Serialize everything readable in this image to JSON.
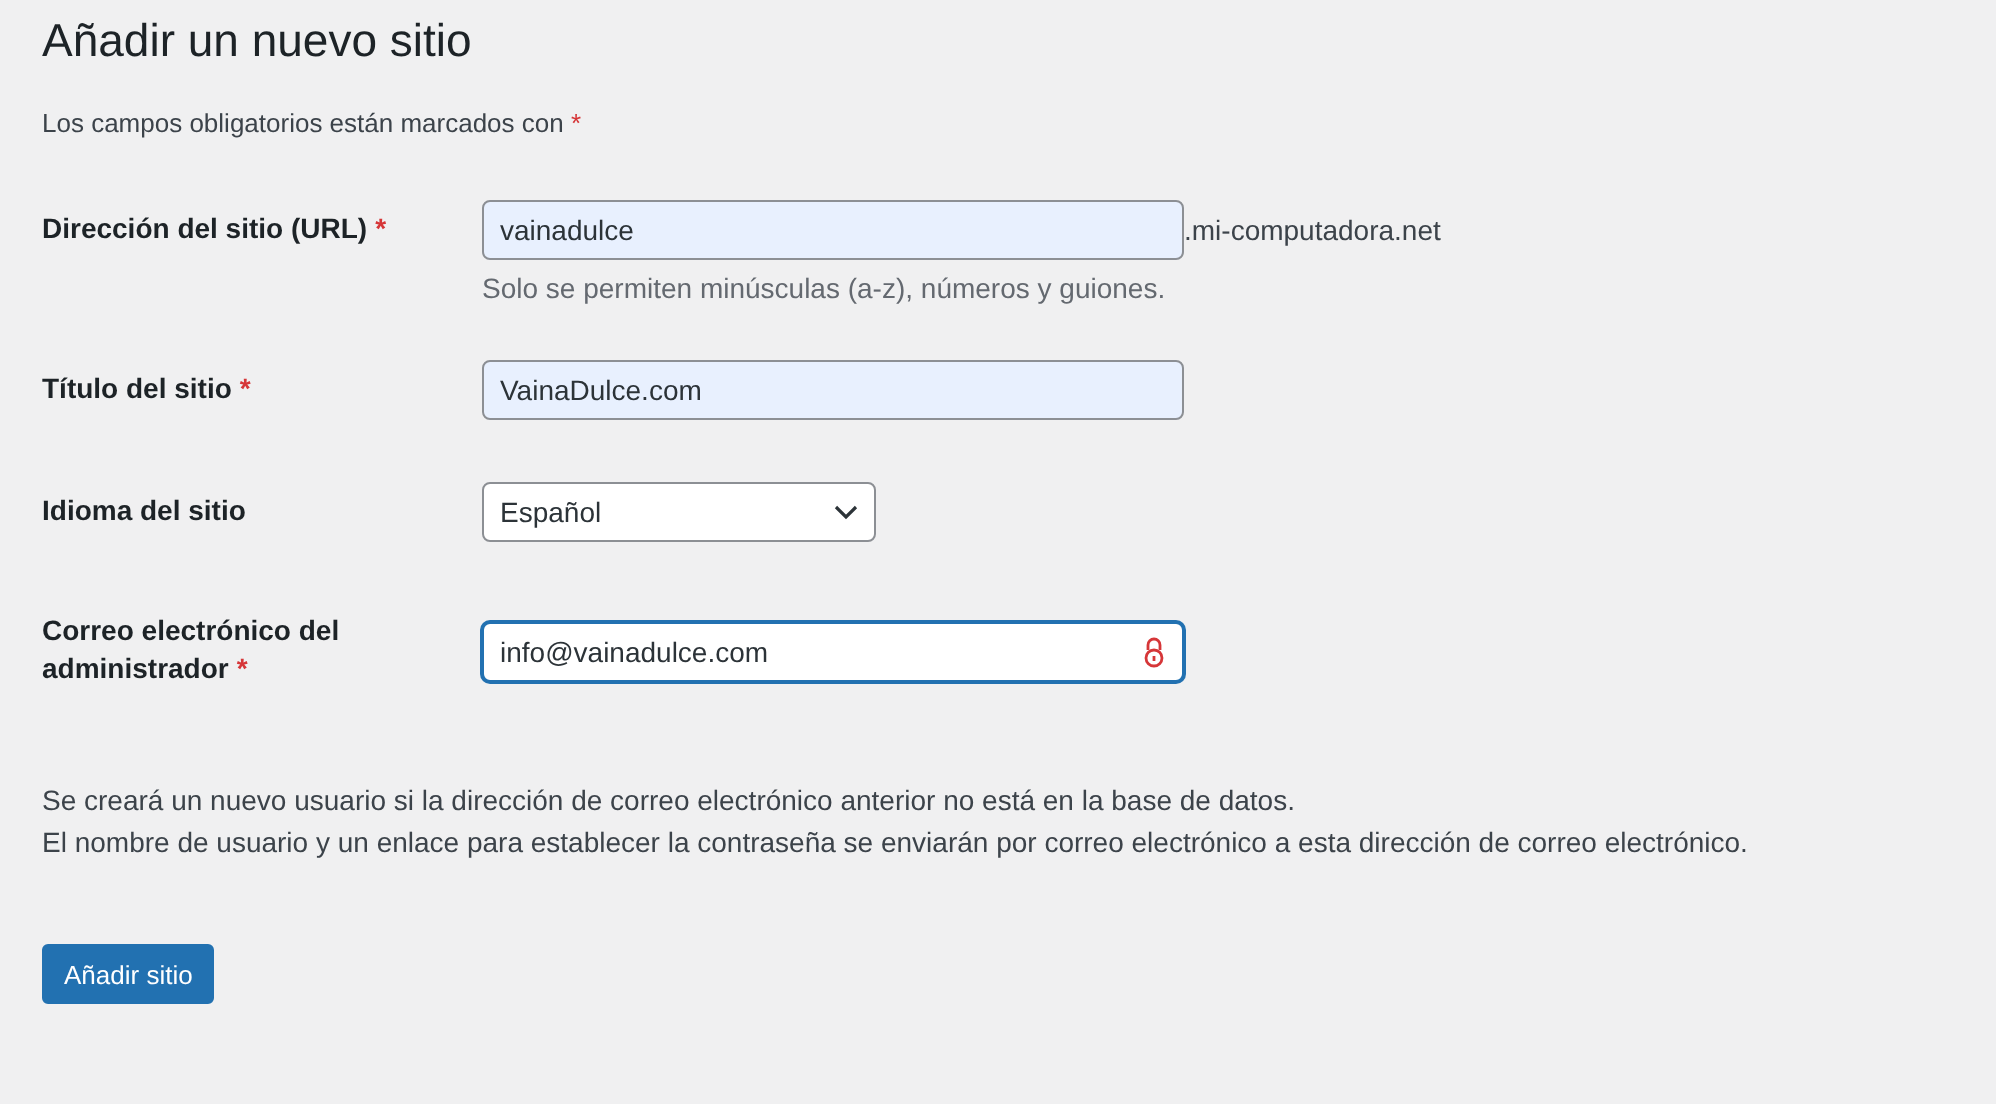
{
  "title": "Añadir un nuevo sitio",
  "required_note": {
    "text": "Los campos obligatorios están marcados con",
    "mark": "*"
  },
  "fields": [
    {
      "kind": "text",
      "label": "Dirección del sitio (URL)",
      "required_mark": "*",
      "value": "vainadulce",
      "autofilled": true,
      "focused": false,
      "suffix": ".mi-computadora.net",
      "hint": "Solo se permiten minúsculas (a-z), números y guiones."
    },
    {
      "kind": "text",
      "label": "Título del sitio",
      "required_mark": "*",
      "value": "VainaDulce.com",
      "autofilled": true,
      "focused": false
    },
    {
      "kind": "select",
      "label": "Idioma del sitio",
      "value": "Español",
      "autofilled": false,
      "focused": false
    },
    {
      "kind": "email",
      "label": "Correo electrónico del administrador",
      "required_mark": "*",
      "value": "info@vainadulce.com",
      "autofilled": false,
      "focused": true
    }
  ],
  "notes": [
    "Se creará un nuevo usuario si la dirección de correo electrónico anterior no está en la base de datos.",
    "El nombre de usuario y un enlace para establecer la contraseña se enviarán por correo electrónico a esta dirección de correo electrónico."
  ],
  "submit": "Añadir sitio"
}
